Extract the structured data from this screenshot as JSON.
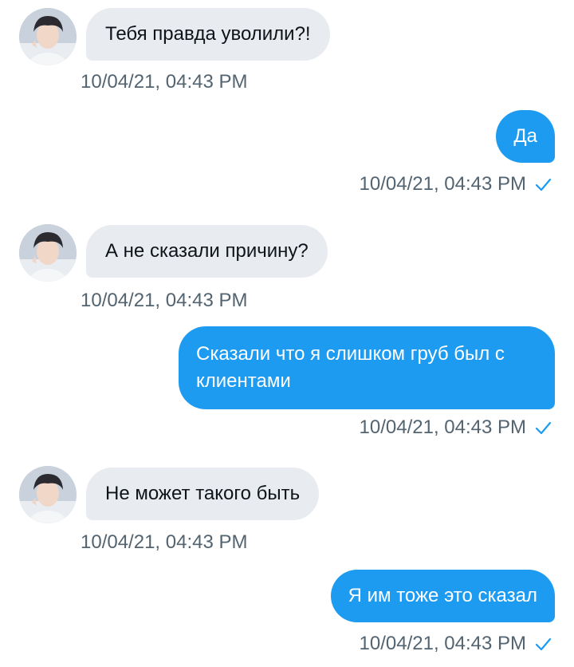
{
  "conversation": {
    "messages": [
      {
        "side": "in",
        "text": "Тебя правда уволили?!",
        "time": "10/04/21, 04:43 PM"
      },
      {
        "side": "out",
        "text": "Да",
        "time": "10/04/21, 04:43 PM",
        "read_icon": "check-icon"
      },
      {
        "side": "in",
        "text": "А не сказали причину?",
        "time": "10/04/21, 04:43 PM"
      },
      {
        "side": "out",
        "text": "Сказали что я слишком груб был с клиентами",
        "time": "10/04/21, 04:43 PM",
        "read_icon": "check-icon"
      },
      {
        "side": "in",
        "text": "Не может такого быть",
        "time": "10/04/21, 04:43 PM"
      },
      {
        "side": "out",
        "text": "Я им тоже это сказал",
        "time": "10/04/21, 04:43 PM",
        "read_icon": "check-icon"
      }
    ]
  },
  "colors": {
    "outgoing_bubble": "#1d9bf0",
    "incoming_bubble": "#e8ebf0",
    "timestamp": "#536471",
    "check": "#1d9bf0"
  }
}
